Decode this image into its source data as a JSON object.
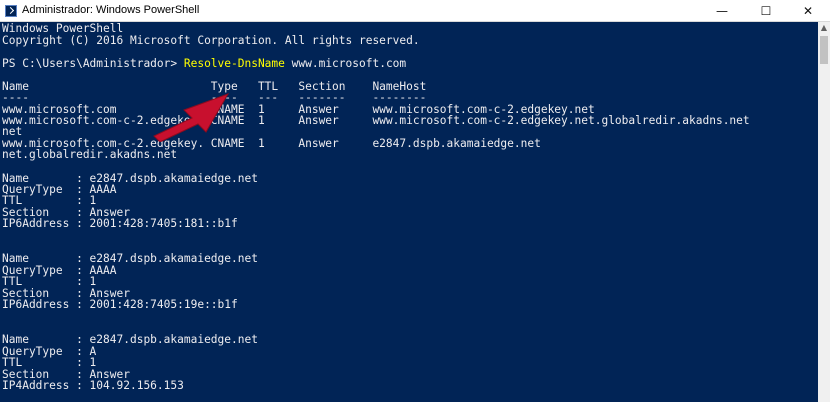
{
  "window": {
    "title": "Administrador: Windows PowerShell",
    "minimize": "—",
    "maximize": "☐",
    "close": "✕"
  },
  "console": {
    "lines": [
      "Windows PowerShell",
      "Copyright (C) 2016 Microsoft Corporation. All rights reserved.",
      "",
      "PS C:\\Users\\Administrador> ",
      "Name                           Type   TTL   Section    NameHost",
      "----                           ----   ---   -------    --------",
      "www.microsoft.com              CNAME  1     Answer     www.microsoft.com-c-2.edgekey.net",
      "www.microsoft.com-c-2.edgekey. CNAME  1     Answer     www.microsoft.com-c-2.edgekey.net.globalredir.akadns.net",
      "net",
      "www.microsoft.com-c-2.edgekey. CNAME  1     Answer     e2847.dspb.akamaiedge.net",
      "net.globalredir.akadns.net",
      "",
      "Name       : e2847.dspb.akamaiedge.net",
      "QueryType  : AAAA",
      "TTL        : 1",
      "Section    : Answer",
      "IP6Address : 2001:428:7405:181::b1f",
      "",
      "",
      "Name       : e2847.dspb.akamaiedge.net",
      "QueryType  : AAAA",
      "TTL        : 1",
      "Section    : Answer",
      "IP6Address : 2001:428:7405:19e::b1f",
      "",
      "",
      "Name       : e2847.dspb.akamaiedge.net",
      "QueryType  : A",
      "TTL        : 1",
      "Section    : Answer",
      "IP4Address : 104.92.156.153"
    ],
    "prompt_command": "Resolve-DnsName",
    "prompt_argument": " www.microsoft.com"
  },
  "colors": {
    "console_bg": "#012456",
    "console_fg": "#eeedf0",
    "command": "#ffff00",
    "arrow": "#c8102e"
  }
}
